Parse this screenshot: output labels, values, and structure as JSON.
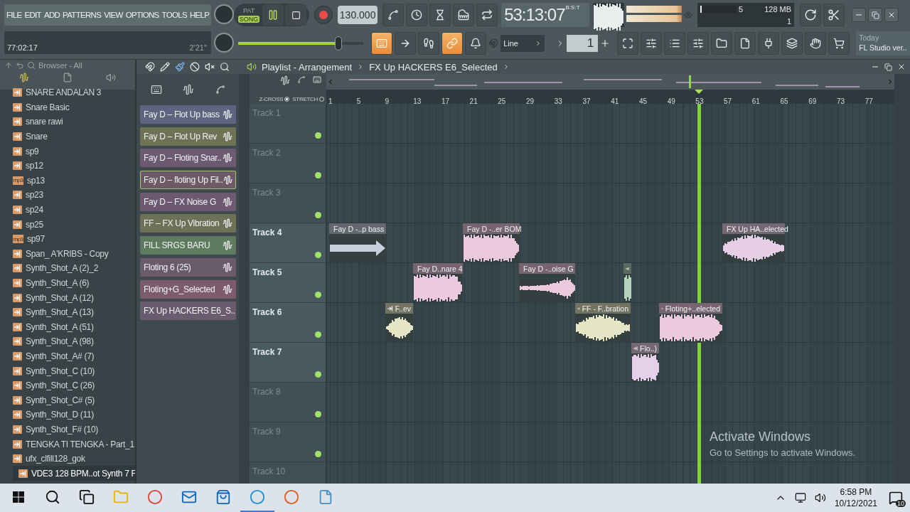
{
  "menu": [
    "FILE",
    "EDIT",
    "ADD",
    "PATTERNS",
    "VIEW",
    "OPTIONS",
    "TOOLS",
    "HELP"
  ],
  "hint": {
    "left": "77:02:17",
    "right": "2'21''"
  },
  "transport": {
    "modes": [
      {
        "label": "PAT",
        "selected": false
      },
      {
        "label": "SONG",
        "selected": true
      }
    ],
    "tempo": "130.000"
  },
  "master_volume": {
    "level": 0.8
  },
  "time_display": {
    "value": "53:13:07",
    "format": "B:S:T"
  },
  "monitor": {
    "cpu": {
      "value": "5",
      "level": 0.04
    },
    "memory": "128 MB",
    "polyphony": "1"
  },
  "record_toggles": [
    {
      "on": true
    },
    {
      "on": false
    },
    {
      "on": false
    },
    {
      "on": true
    },
    {
      "on": false
    }
  ],
  "snap": {
    "value": "Line"
  },
  "pattern": {
    "value": "1"
  },
  "news": {
    "date": "Today",
    "headline": "FL Studio ver.."
  },
  "browser": {
    "title": "Browser - All",
    "items": [
      {
        "label": "SNARE ANDALAN 3",
        "selected": false
      },
      {
        "label": "Snare Basic",
        "selected": false
      },
      {
        "label": "snare rawi",
        "selected": false
      },
      {
        "label": "Snare",
        "selected": false
      },
      {
        "label": "sp9",
        "selected": false
      },
      {
        "label": "sp12",
        "selected": false
      },
      {
        "label": "sp13",
        "badge": "mp3",
        "selected": false
      },
      {
        "label": "sp23",
        "selected": false
      },
      {
        "label": "sp24",
        "selected": false
      },
      {
        "label": "sp25",
        "selected": false
      },
      {
        "label": "sp97",
        "badge": "mp3",
        "selected": false
      },
      {
        "label": "Span_ A'KRIBS - Copy",
        "selected": false
      },
      {
        "label": "Synth_Shot_A (2)_2",
        "selected": false
      },
      {
        "label": "Synth_Shot_A (6)",
        "selected": false
      },
      {
        "label": "Synth_Shot_A (12)",
        "selected": false
      },
      {
        "label": "Synth_Shot_A (13)",
        "selected": false
      },
      {
        "label": "Synth_Shot_A (51)",
        "selected": false
      },
      {
        "label": "Synth_Shot_A (98)",
        "selected": false
      },
      {
        "label": "Synth_Shot_A# (7)",
        "selected": false
      },
      {
        "label": "Synth_Shot_C (10)",
        "selected": false
      },
      {
        "label": "Synth_Shot_C (26)",
        "selected": false
      },
      {
        "label": "Synth_Shot_C# (5)",
        "selected": false
      },
      {
        "label": "Synth_Shot_D (11)",
        "selected": false
      },
      {
        "label": "Synth_Shot_F# (10)",
        "selected": false
      },
      {
        "label": "TENGKA TI TENGKA - Part_1",
        "selected": false
      },
      {
        "label": "ufx_clfill128_gok",
        "selected": false
      },
      {
        "label": "VDE3 128 BPM..ot Synth 7 F",
        "selected": true
      }
    ]
  },
  "playlist": {
    "title": "Playlist - Arrangement",
    "pattern": "FX Up HACKERS E6_Selected",
    "patterns": [
      {
        "label": "Fay D – Flot Up bass",
        "color": "#5d6581",
        "selected": false
      },
      {
        "label": "Fay D – Flot Up Rev",
        "color": "#6e7257",
        "selected": false
      },
      {
        "label": "Fay D – Floting Snar..",
        "color": "#6b5a72",
        "selected": false
      },
      {
        "label": "Fay D – floting Up Fil..",
        "color": "#6c5b66",
        "selected": true
      },
      {
        "label": "Fay D – FX Noise G",
        "color": "#6d5a72",
        "selected": false
      },
      {
        "label": "FF – FX Up Vibration",
        "color": "#6c7157",
        "selected": false
      },
      {
        "label": "FILL SRGS BARU",
        "color": "#5e7a5f",
        "selected": false
      },
      {
        "label": "Floting 6  (25)",
        "color": "#6a5b6c",
        "selected": false
      },
      {
        "label": "Floting+G_Selected",
        "color": "#7b5b6c",
        "selected": false
      },
      {
        "label": "FX Up HACKERS E6_S..",
        "color": "#6a5b6e",
        "selected": false
      }
    ],
    "options": [
      {
        "label": "Z-CROSS",
        "on": true
      },
      {
        "label": "STRETCH",
        "on": false
      }
    ],
    "ruler": [
      "1",
      "5",
      "9",
      "13",
      "17",
      "21",
      "25",
      "29",
      "33",
      "37",
      "41",
      "45",
      "49",
      "53",
      "57",
      "61",
      "65",
      "69",
      "73",
      "77"
    ],
    "tracks": [
      {
        "name": "Track 1",
        "dimmed": true,
        "enabled": true
      },
      {
        "name": "Track 2",
        "dimmed": true,
        "enabled": true
      },
      {
        "name": "Track 3",
        "dimmed": true,
        "enabled": true
      },
      {
        "name": "Track 4",
        "dimmed": false,
        "enabled": true,
        "clips": [
          {
            "label": "Fay D -..p bass",
            "kind": "arrow",
            "color": "#c9d0dd"
          },
          {
            "label": "Fay D -..er BOM",
            "kind": "wave",
            "color": "#ecc9dc"
          },
          {
            "label": "FX Up HA..elected",
            "kind": "wave",
            "color": "#e6cfe6"
          }
        ]
      },
      {
        "name": "Track 5",
        "dimmed": false,
        "enabled": true,
        "clips": [
          {
            "label": "Fay D..nare 4",
            "kind": "wave",
            "color": "#ecc9e0"
          },
          {
            "label": "Fay D -..oise G",
            "kind": "wave",
            "color": "#ecc9dc"
          },
          {
            "kind": "wave",
            "color": "#b4d4bd"
          }
        ]
      },
      {
        "name": "Track 6",
        "dimmed": false,
        "enabled": true,
        "clips": [
          {
            "label": "F..ev",
            "kind": "wave",
            "color": "#e4e6c6"
          },
          {
            "label": "FF - F..bration",
            "kind": "wave",
            "color": "#e4e6c6"
          },
          {
            "label": "Floting+..elected",
            "kind": "wave",
            "color": "#ecc9dc"
          }
        ]
      },
      {
        "name": "Track 7",
        "dimmed": false,
        "enabled": true,
        "clips": [
          {
            "label": "Flo..)",
            "kind": "wave",
            "color": "#e6cfe8"
          }
        ]
      },
      {
        "name": "Track 8",
        "dimmed": true,
        "enabled": true
      },
      {
        "name": "Track 9",
        "dimmed": true,
        "enabled": true
      },
      {
        "name": "Track 10",
        "dimmed": true
      }
    ]
  },
  "activation": {
    "title": "Activate Windows",
    "text": "Go to Settings to activate Windows."
  },
  "taskbar": {
    "apps": [
      {
        "active": false
      },
      {
        "active": false
      },
      {
        "active": false
      },
      {
        "active": false
      },
      {
        "active": false
      },
      {
        "active": false
      },
      {
        "active": true
      },
      {
        "active": false
      },
      {
        "active": false
      }
    ],
    "time": "6:58 PM",
    "date": "10/12/2021",
    "notifications": "10"
  }
}
